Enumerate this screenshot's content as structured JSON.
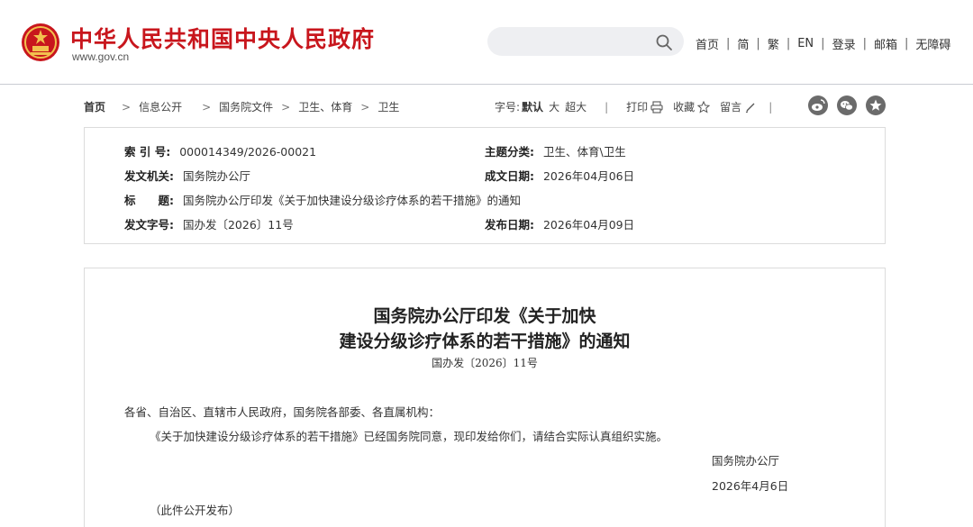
{
  "header": {
    "site_title": "中华人民共和国中央人民政府",
    "site_url": "www.gov.cn",
    "search": {
      "value": "",
      "placeholder": ""
    },
    "nav": {
      "home": "首页",
      "simplified": "简",
      "traditional": "繁",
      "english": "EN",
      "login": "登录",
      "mailbox": "邮箱",
      "accessibility": "无障碍",
      "separator": "|"
    },
    "colors": {
      "brand_red": "#c8161d"
    }
  },
  "breadcrumb": {
    "items": [
      "首页",
      "信息公开",
      "国务院文件",
      "卫生、体育",
      "卫生"
    ],
    "separator": ">"
  },
  "toolbar": {
    "font_size_label": "字号:",
    "font_default": "默认",
    "font_large": "大",
    "font_xlarge": "超大",
    "divider": "|",
    "print": "打印",
    "favorite": "收藏",
    "comment": "留言",
    "share_icons": [
      "weibo-icon",
      "wechat-icon",
      "star-icon"
    ]
  },
  "metadata": {
    "index_label": "索 引 号:",
    "index_value": "000014349/2026-00021",
    "category_label": "主题分类:",
    "category_value": "卫生、体育\\卫生",
    "issuer_label": "发文机关:",
    "issuer_value": "国务院办公厅",
    "written_label": "成文日期:",
    "written_value": "2026年04月06日",
    "title_label": "标　　题:",
    "title_value": "国务院办公厅印发《关于加快建设分级诊疗体系的若干措施》的通知",
    "docno_label": "发文字号:",
    "docno_value": "国办发〔2026〕11号",
    "published_label": "发布日期:",
    "published_value": "2026年04月09日"
  },
  "article": {
    "title_line1": "国务院办公厅印发《关于加快",
    "title_line2": "建设分级诊疗体系的若干措施》的通知",
    "doc_no": "国办发〔2026〕11号",
    "salutation": "各省、自治区、直辖市人民政府，国务院各部委、各直属机构：",
    "body": "《关于加快建设分级诊疗体系的若干措施》已经国务院同意，现印发给你们，请结合实际认真组织实施。",
    "signature": "国务院办公厅",
    "date": "2026年4月6日",
    "note": "（此件公开发布）"
  }
}
